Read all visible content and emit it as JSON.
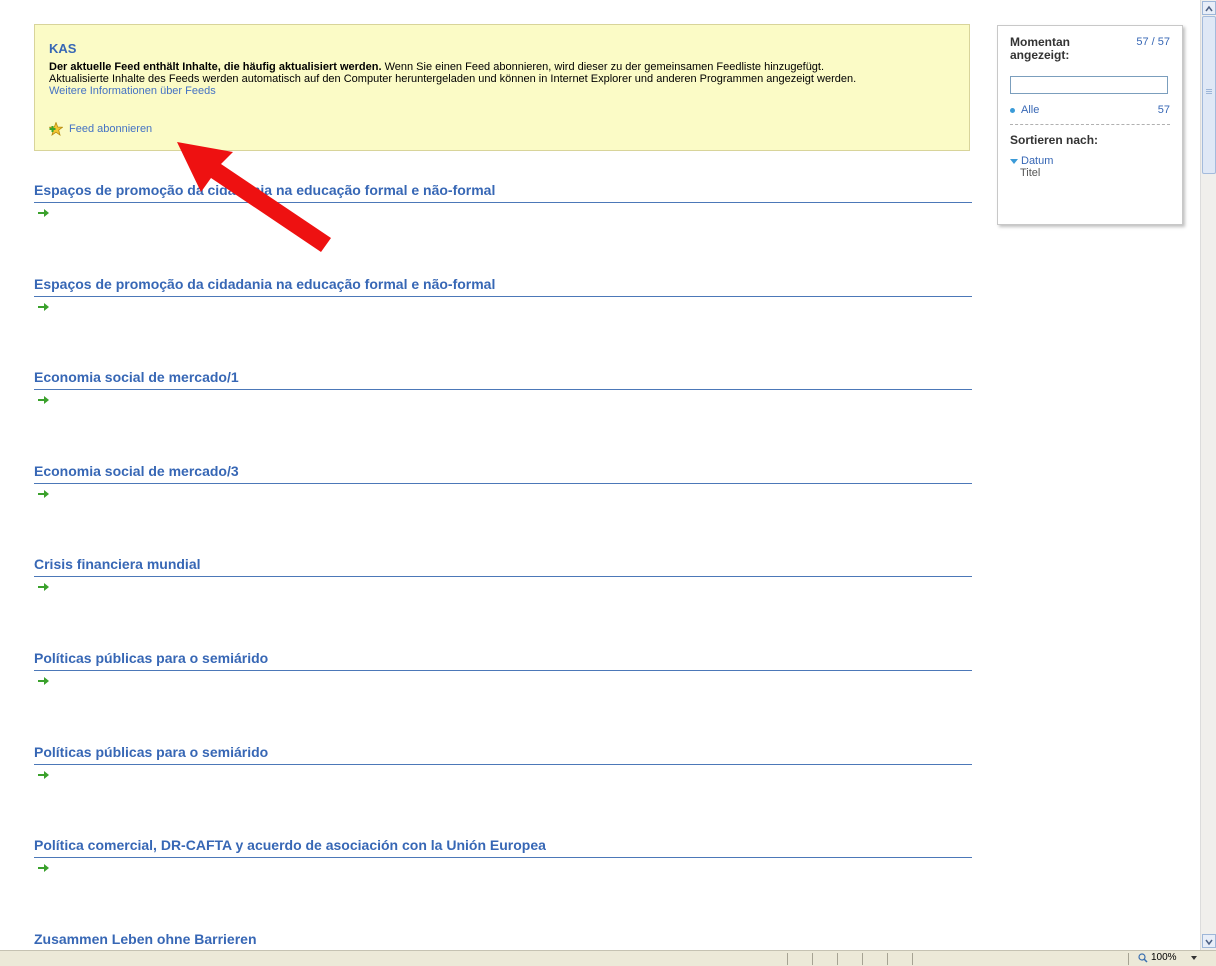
{
  "feed": {
    "title": "KAS",
    "desc_bold": "Der aktuelle Feed enthält Inhalte, die häufig aktualisiert werden.",
    "desc_rest": " Wenn Sie einen Feed abonnieren, wird dieser zu der gemeinsamen Feedliste hinzugefügt.",
    "desc_line2": "Aktualisierte Inhalte des Feeds werden automatisch auf den Computer heruntergeladen und können in Internet Explorer und anderen Programmen angezeigt werden.",
    "more_info_link": "Weitere Informationen über Feeds",
    "subscribe_label": "Feed abonnieren"
  },
  "items": [
    {
      "title": "Espaços de promoção da cidadania na educação formal e não-formal"
    },
    {
      "title": "Espaços de promoção da cidadania na educação formal e não-formal"
    },
    {
      "title": "Economia social de mercado/1"
    },
    {
      "title": "Economia social de mercado/3"
    },
    {
      "title": "Crisis financiera mundial"
    },
    {
      "title": "Políticas públicas para o semiárido"
    },
    {
      "title": "Políticas públicas para o semiárido"
    },
    {
      "title": "Política comercial, DR-CAFTA y acuerdo de asociación con la Unión Europea"
    },
    {
      "title": "Zusammen Leben ohne Barrieren"
    }
  ],
  "sidebar": {
    "shown_label_1": "Momentan",
    "shown_label_2": "angezeigt:",
    "shown_count": "57 / 57",
    "filter_placeholder": "",
    "all_label": "Alle",
    "all_count": "57",
    "sort_label": "Sortieren nach:",
    "sort_date": "Datum",
    "sort_title": "Titel"
  },
  "statusbar": {
    "zoom": "100%"
  },
  "colors": {
    "link": "#3767b5",
    "infobox_bg": "#fbfbc6",
    "annotation_arrow": "#ee1111"
  },
  "icons": {
    "subscribe": "feed-star-icon",
    "item_arrow": "green-arrow-icon"
  }
}
